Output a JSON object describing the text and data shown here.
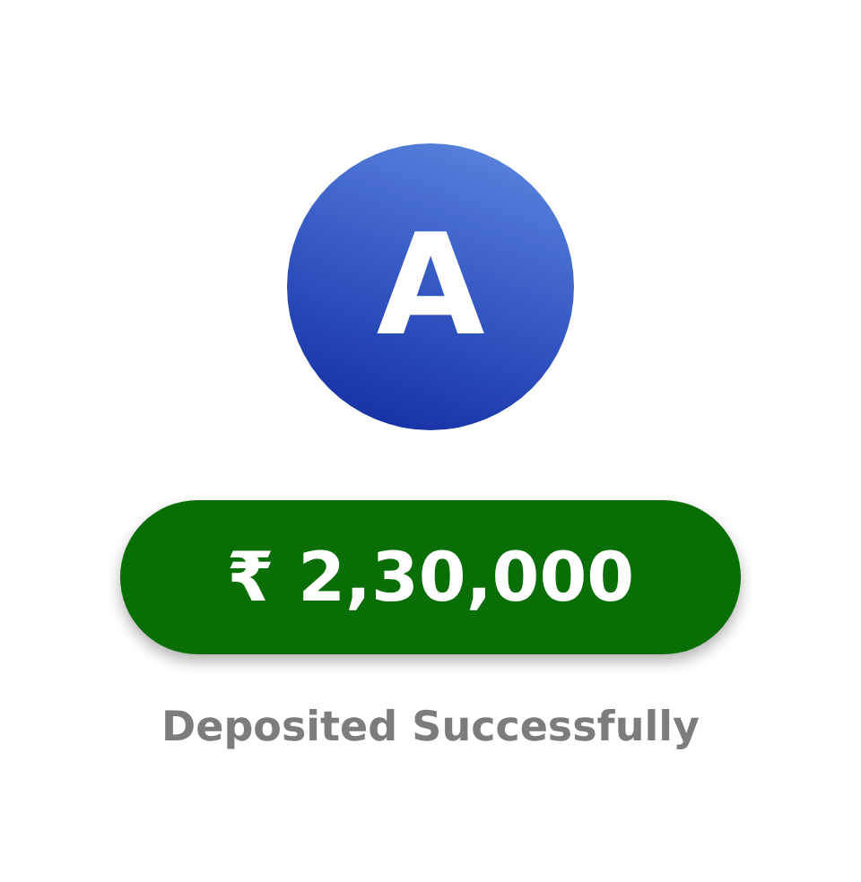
{
  "avatar": {
    "initial": "A"
  },
  "amount": "₹ 2,30,000",
  "status": "Deposited Successfully"
}
